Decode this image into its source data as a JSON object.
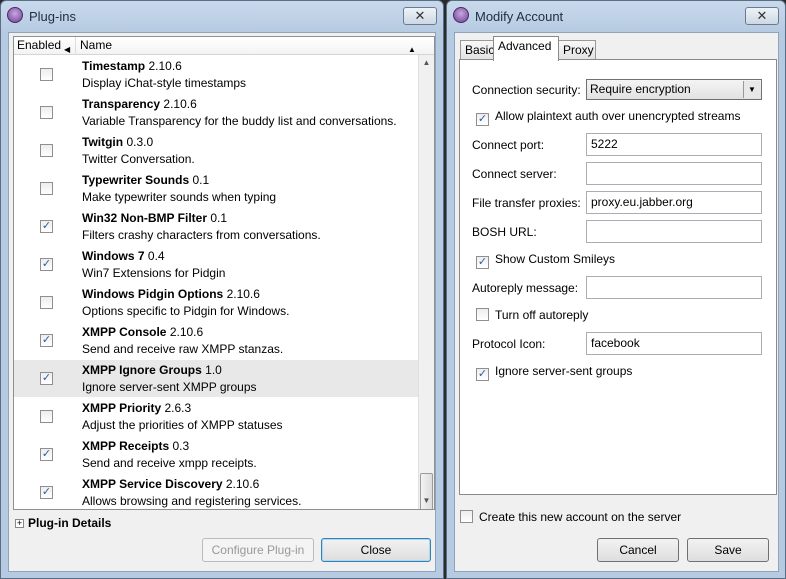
{
  "plugins_window": {
    "title": "Plug-ins",
    "close_glyph": "✕",
    "columns": {
      "enabled": "Enabled",
      "name": "Name"
    },
    "plugins": [
      {
        "name": "Timestamp",
        "version": "2.10.6",
        "desc": "Display iChat-style timestamps",
        "enabled": false
      },
      {
        "name": "Transparency",
        "version": "2.10.6",
        "desc": "Variable Transparency for the buddy list and conversations.",
        "enabled": false
      },
      {
        "name": "Twitgin",
        "version": "0.3.0",
        "desc": "Twitter Conversation.",
        "enabled": false
      },
      {
        "name": "Typewriter Sounds",
        "version": "0.1",
        "desc": "Make typewriter sounds when typing",
        "enabled": false
      },
      {
        "name": "Win32 Non-BMP Filter",
        "version": "0.1",
        "desc": "Filters crashy characters from conversations.",
        "enabled": true
      },
      {
        "name": "Windows 7",
        "version": "0.4",
        "desc": "Win7 Extensions for Pidgin",
        "enabled": true
      },
      {
        "name": "Windows Pidgin Options",
        "version": "2.10.6",
        "desc": "Options specific to Pidgin for Windows.",
        "enabled": false
      },
      {
        "name": "XMPP Console",
        "version": "2.10.6",
        "desc": "Send and receive raw XMPP stanzas.",
        "enabled": true
      },
      {
        "name": "XMPP Ignore Groups",
        "version": "1.0",
        "desc": "Ignore server-sent XMPP groups",
        "enabled": true,
        "selected": true
      },
      {
        "name": "XMPP Priority",
        "version": "2.6.3",
        "desc": "Adjust the priorities of XMPP statuses",
        "enabled": false
      },
      {
        "name": "XMPP Receipts",
        "version": "0.3",
        "desc": "Send and receive xmpp receipts.",
        "enabled": true
      },
      {
        "name": "XMPP Service Discovery",
        "version": "2.10.6",
        "desc": "Allows browsing and registering services.",
        "enabled": true
      }
    ],
    "details_label": "Plug-in Details",
    "configure_button": "Configure Plug-in",
    "close_button": "Close"
  },
  "account_window": {
    "title": "Modify Account",
    "close_glyph": "✕",
    "tabs": [
      "Basic",
      "Advanced",
      "Proxy"
    ],
    "active_tab": "Advanced",
    "connection_security_label": "Connection security:",
    "connection_security_value": "Require encryption",
    "allow_plaintext_label": "Allow plaintext auth over unencrypted streams",
    "allow_plaintext_checked": true,
    "connect_port_label": "Connect port:",
    "connect_port_value": "5222",
    "connect_server_label": "Connect server:",
    "connect_server_value": "",
    "file_proxies_label": "File transfer proxies:",
    "file_proxies_value": "proxy.eu.jabber.org",
    "bosh_label": "BOSH URL:",
    "bosh_value": "",
    "show_smileys_label": "Show Custom Smileys",
    "show_smileys_checked": true,
    "autoreply_label": "Autoreply message:",
    "autoreply_value": "",
    "turn_off_autoreply_label": "Turn off autoreply",
    "turn_off_autoreply_checked": false,
    "protocol_icon_label": "Protocol Icon:",
    "protocol_icon_value": "facebook",
    "ignore_groups_label": "Ignore server-sent groups",
    "ignore_groups_checked": true,
    "create_account_label": "Create this new account on the server",
    "create_account_checked": false,
    "cancel_button": "Cancel",
    "save_button": "Save"
  },
  "colors": {
    "titlebar": "#b6cbe2",
    "check": "#2a5d9f",
    "selected_row": "#e8e8e8"
  },
  "icons": {
    "check": "✓",
    "dropdown": "▼",
    "sort_left": "◀",
    "sort_up": "▲",
    "scroll_up": "▲",
    "scroll_down": "▼",
    "expander": "+"
  }
}
